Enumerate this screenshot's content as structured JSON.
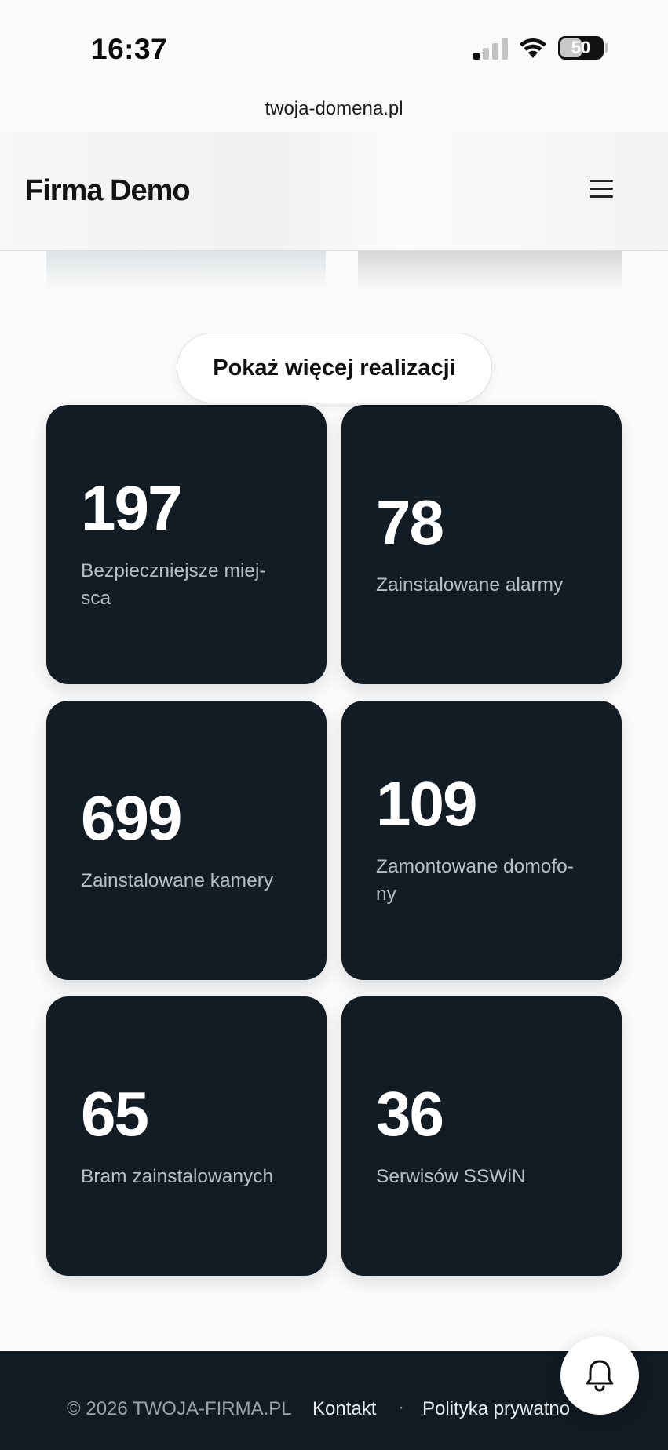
{
  "status_bar": {
    "time": "16:37",
    "battery_level": "50"
  },
  "browser": {
    "url": "twoja-domena.pl"
  },
  "header": {
    "logo_text": "Firma Demo",
    "menu_icon": "hamburger-menu-icon"
  },
  "gallery": {
    "show_more_label": "Pokaż więcej realizacji"
  },
  "stats": [
    {
      "value": "197",
      "label": "Bezpieczniejsze miej-sca"
    },
    {
      "value": "78",
      "label": "Zainstalowane alarmy"
    },
    {
      "value": "699",
      "label": "Zainstalowane kamery"
    },
    {
      "value": "109",
      "label": "Zamontowane domofo-ny"
    },
    {
      "value": "65",
      "label": "Bram zainstalowanych"
    },
    {
      "value": "36",
      "label": "Serwisów SSWiN"
    }
  ],
  "footer": {
    "copyright": "© 2026 TWOJA-FIRMA.PL",
    "contact_link": "Kontakt",
    "separator": "·",
    "privacy_link": "Polityka prywatno"
  },
  "floating_button": {
    "icon": "bell-icon"
  },
  "colors": {
    "card_background": "#121c25",
    "footer_background": "#111b24",
    "page_background": "#fbfbfb"
  }
}
